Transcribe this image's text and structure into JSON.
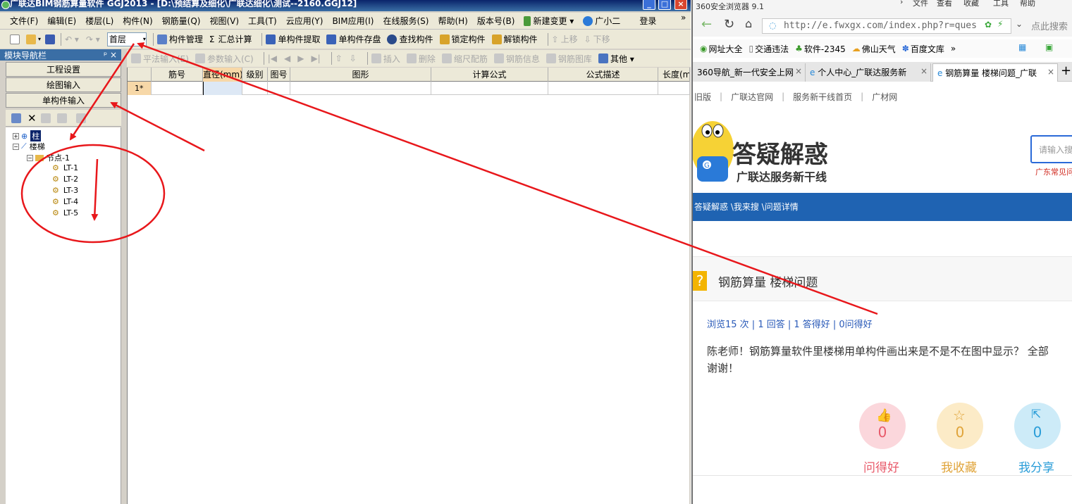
{
  "app": {
    "title": "广联达BIM钢筋算量软件 GGJ2013 - [D:\\预结算及细化\\广联达细化\\测试--2160.GGJ12]",
    "menu": [
      "文件(F)",
      "编辑(E)",
      "楼层(L)",
      "构件(N)",
      "钢筋量(Q)",
      "视图(V)",
      "工具(T)",
      "云应用(Y)",
      "BIM应用(I)",
      "在线服务(S)",
      "帮助(H)",
      "版本号(B)",
      "新建变更 ▾",
      "广小二",
      "登录"
    ],
    "toolbar": {
      "floor": "首层",
      "items": [
        "构件管理",
        "汇总计算",
        "单构件提取",
        "单构件存盘",
        "查找构件",
        "锁定构件",
        "解锁构件",
        "上移",
        "下移"
      ]
    },
    "nav": {
      "title": "模块导航栏",
      "pin": "ᵖ ×",
      "buttons": [
        "工程设置",
        "绘图输入",
        "单构件输入"
      ]
    },
    "tree": {
      "root1": "柱",
      "root2": "楼梯",
      "node": "节点-1",
      "leaves": [
        "LT-1",
        "LT-2",
        "LT-3",
        "LT-4",
        "LT-5"
      ]
    },
    "tool2": [
      "平法输入(E)",
      "参数输入(C)",
      "插入",
      "删除",
      "缩尺配筋",
      "钢筋信息",
      "钢筋图库",
      "其他 ▾"
    ],
    "grid": {
      "headers": [
        "",
        "筋号",
        "直径(mm)",
        "级别",
        "图号",
        "图形",
        "计算公式",
        "公式描述",
        "长度(mm)"
      ],
      "row_no": "1*"
    }
  },
  "browser": {
    "title": "360安全浏览器 9.1",
    "top_menu": [
      "文件",
      "查看",
      "收藏",
      "工具",
      "帮助"
    ],
    "url": "http://e.fwxgx.com/index.php?r=ques",
    "search_placeholder": "点此搜索",
    "bookmarks": [
      "网址大全",
      "交通违法",
      "软件-2345",
      "佛山天气",
      "百度文库",
      "»"
    ],
    "tabs": [
      "360导航_新一代安全上网",
      "个人中心_广联达服务新",
      "钢筋算量 楼梯问题_广联"
    ],
    "site_nav": [
      "旧版",
      "广联达官网",
      "服务新干线首页",
      "广材网"
    ],
    "brand_title": "答疑解惑",
    "brand_sub": "广联达服务新干线",
    "search_hint": "请输入搜索",
    "region": "广东常见问",
    "breadcrumb": "答疑解惑 \\我来搜 \\问题详情",
    "question_mark": "?",
    "question_title": "钢筋算量 楼梯问题",
    "stats": "浏览15 次 | 1 回答 | 1 答得好 | 0问得好",
    "body_line1": "陈老师！钢筋算量软件里楼梯用单构件画出来是不是不在图中显示？ 全部",
    "body_line2": "谢谢！",
    "actions": [
      {
        "count": "0",
        "label": "问得好",
        "color": "#e85a6a",
        "bg": "#fbd7dc"
      },
      {
        "count": "0",
        "label": "我收藏",
        "color": "#e0a43a",
        "bg": "#fcebc7"
      },
      {
        "count": "0",
        "label": "我分享",
        "color": "#2a9dd8",
        "bg": "#cdebf8"
      }
    ]
  },
  "colors": {
    "annotation": "#e8171b",
    "nav_blue": "#1f63b2"
  }
}
